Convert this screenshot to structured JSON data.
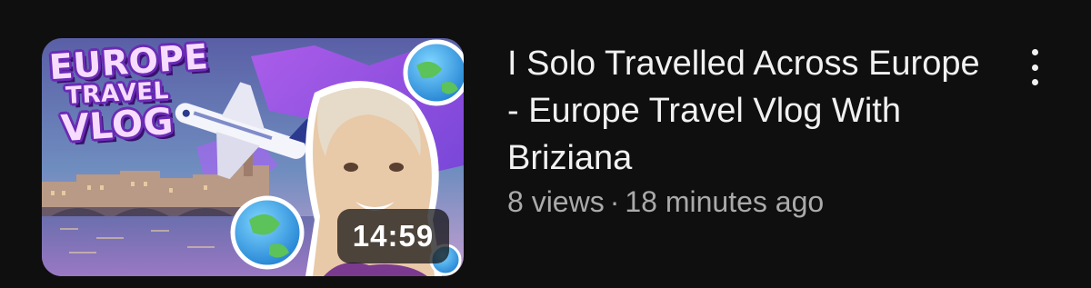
{
  "video": {
    "thumbnail": {
      "overlay_title": {
        "line1": "EUROPE",
        "line2": "TRAVEL",
        "line3": "VLOG"
      },
      "duration": "14:59",
      "colors": {
        "accent": "#b14cff",
        "sky": "#4f6fa8",
        "title_outline": "#6b2bb5"
      }
    },
    "title": "I Solo Travelled Across Europe - Europe Travel Vlog With Briziana",
    "views": "8 views",
    "separator": "·",
    "published": "18 minutes ago",
    "menu_icon": "more-vert-icon"
  }
}
